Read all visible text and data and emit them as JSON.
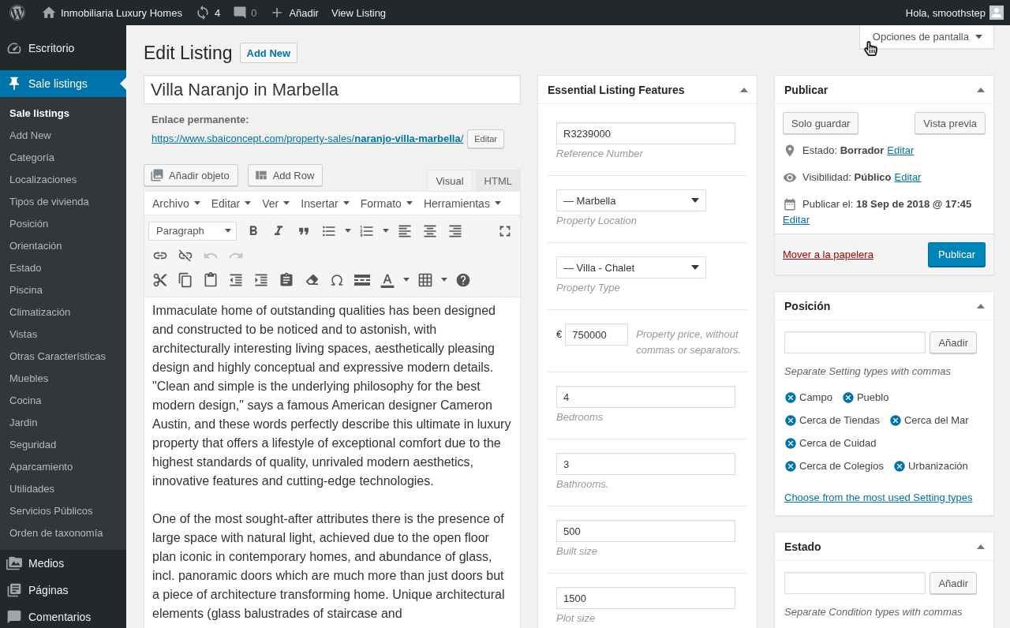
{
  "admin_bar": {
    "site_name": "Inmobiliaria Luxury Homes",
    "updates": "4",
    "comments": "0",
    "new": "Añadir",
    "view": "View Listing",
    "greeting": "Hola, smoothstep"
  },
  "sidebar": {
    "items": [
      {
        "label": "Escritorio",
        "selected": false
      },
      {
        "label": "Sale listings",
        "selected": true,
        "children": [
          {
            "label": "Sale listings",
            "selected": true
          },
          {
            "label": "Add New",
            "selected": false
          },
          {
            "label": "Categoría",
            "selected": false
          },
          {
            "label": "Localizaciones",
            "selected": false
          },
          {
            "label": "Tipos de vivienda",
            "selected": false
          },
          {
            "label": "Posición",
            "selected": false
          },
          {
            "label": "Orientación",
            "selected": false
          },
          {
            "label": "Estado",
            "selected": false
          },
          {
            "label": "Piscina",
            "selected": false
          },
          {
            "label": "Climatización",
            "selected": false
          },
          {
            "label": "Vistas",
            "selected": false
          },
          {
            "label": "Otras Características",
            "selected": false
          },
          {
            "label": "Muebles",
            "selected": false
          },
          {
            "label": "Cocina",
            "selected": false
          },
          {
            "label": "Jardin",
            "selected": false
          },
          {
            "label": "Seguridad",
            "selected": false
          },
          {
            "label": "Aparcamiento",
            "selected": false
          },
          {
            "label": "Utilidades",
            "selected": false
          },
          {
            "label": "Servicios Públicos",
            "selected": false
          },
          {
            "label": "Orden de taxonomía",
            "selected": false
          }
        ]
      },
      {
        "label": "Medios",
        "selected": false
      },
      {
        "label": "Páginas",
        "selected": false
      },
      {
        "label": "Comentarios",
        "selected": false
      }
    ]
  },
  "screen_options": "Opciones de pantalla",
  "heading": {
    "title": "Edit Listing",
    "add_new": "Add New"
  },
  "post_title": "Villa Naranjo in Marbella",
  "permalink": {
    "label": "Enlace permanente:",
    "url": "https://www.sbaiconcept.com/property-sales/**naranjo-villa-marbella**/",
    "edit": "Editar"
  },
  "editor": {
    "media_buttons": [
      "Añadir objeto",
      "Add Row"
    ],
    "tabs": [
      {
        "label": "Visual",
        "selected": true
      },
      {
        "label": "HTML",
        "selected": false
      }
    ],
    "menus": [
      "Archivo",
      "Editar",
      "Ver",
      "Insertar",
      "Formato",
      "Herramientas"
    ],
    "block_format": "Paragraph",
    "undo": {
      "disabled": true
    },
    "redo": {
      "disabled": true
    },
    "paragraphs": [
      "Immaculate home of outstanding qualities has been designed and constructed to be noticed and to astonish, with architecturally interesting living spaces, aesthetically pleasing design and highly conceptual and expressive modern details. \"Clean and simple is the underlying philosophy for the best modern design,\" says a famous American designer Cameron Austin, and these words perfectly describe this ultimate in luxury property that offers a lifestyle of exceptional comfort due to the highest standards of quality, unrivaled modern aesthetics, innovative features and cutting-edge technologies.",
      "One of the most sought-after attributes there is the presence of large space with natural light, achieved due to the open floor plan iconic in contemporary homes, and abundance of glass, incl. panoramic doors which are much more than just doors but a piece of architecture transforming home. Unique architectural elements (glass balustrades of staircase and"
    ]
  },
  "features": {
    "title": "Essential Listing Features",
    "expanded": true,
    "fields": [
      {
        "kind": "text",
        "value": "R3239000",
        "label": "Reference Number"
      },
      {
        "kind": "select",
        "value": "— Marbella",
        "label": "Property Location"
      },
      {
        "kind": "select",
        "value": "— Villa - Chalet",
        "label": "Property Type"
      },
      {
        "kind": "price",
        "prefix": "€",
        "value": "750000",
        "label": "Property price, without commas or separators."
      },
      {
        "kind": "text",
        "value": "4",
        "label": "Bedrooms"
      },
      {
        "kind": "text",
        "value": "3",
        "label": "Bathrooms."
      },
      {
        "kind": "text",
        "value": "500",
        "label": "Built size"
      },
      {
        "kind": "text",
        "value": "1500",
        "label": "Plot size"
      }
    ]
  },
  "publish": {
    "title": "Publicar",
    "expanded": true,
    "save_draft": "Solo guardar",
    "preview": "Vista previa",
    "rows": [
      {
        "kind": "status",
        "text": "Estado: **Borrador**",
        "link": "Editar"
      },
      {
        "kind": "visibility",
        "text": "Visibilidad: **Público**",
        "link": "Editar"
      },
      {
        "kind": "schedule",
        "text": "Publicar el: **18 Sep de 2018 @ 17:45**",
        "link": "Editar"
      }
    ],
    "trash": "Mover a la papelera",
    "publish": "Publicar"
  },
  "taxonomies": [
    {
      "title": "Posición",
      "expanded": true,
      "add": "Añadir",
      "hint": "Separate Setting types with commas",
      "tags": [
        "Campo",
        "Pueblo",
        "Cerca de Tiendas",
        "Cerca del Mar",
        "Cerca de Cuidad",
        "Cerca de Colegios",
        "Urbanización"
      ],
      "link": "Choose from the most used Setting types"
    },
    {
      "title": "Estado",
      "expanded": true,
      "add": "Añadir",
      "hint": "Separate Condition types with commas"
    }
  ]
}
